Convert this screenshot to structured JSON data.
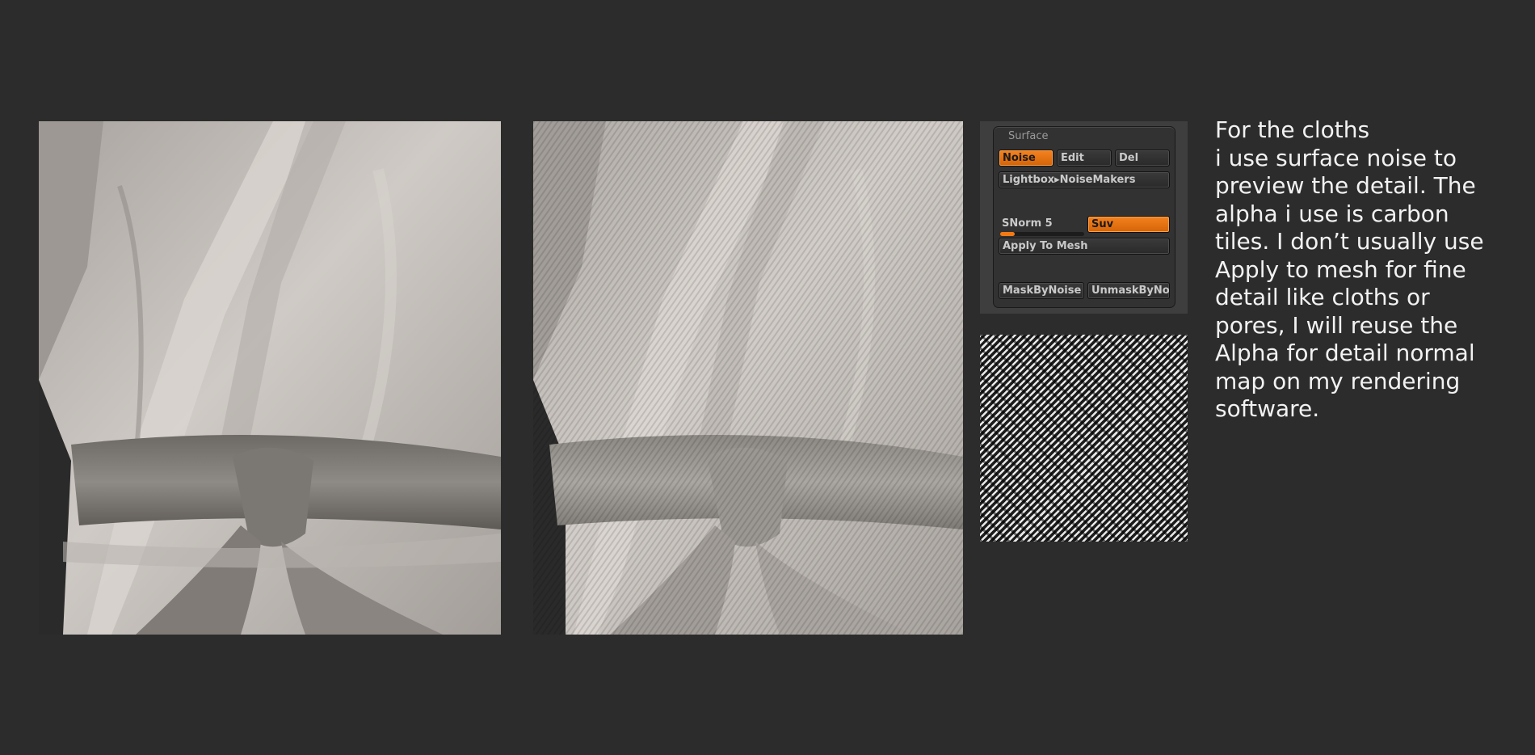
{
  "renders": {
    "before": {
      "description_name": "robe-render-without-noise",
      "cloth_color": "#bdb8b3",
      "belt_color": "#8a8580"
    },
    "after": {
      "description_name": "robe-render-with-surface-noise",
      "cloth_color": "#c2beb9",
      "belt_color": "#a8a39e"
    }
  },
  "surface_panel": {
    "title": "Surface",
    "noise_button": "Noise",
    "edit_button": "Edit",
    "del_button": "Del",
    "lightbox_button": "Lightbox▸NoiseMakers",
    "snorm_label": "SNorm 5",
    "snorm_value": 5,
    "suv_button": "Suv",
    "apply_button": "Apply To Mesh",
    "maskbynoise_button": "MaskByNoise",
    "unmaskbynoise_button": "UnmaskByNo",
    "accent_color": "#f27a14"
  },
  "alpha": {
    "icon": "carbon-tiles-alpha"
  },
  "note": {
    "lines": [
      "For the cloths",
      "i use surface noise to",
      "preview the detail. The",
      "alpha i use is carbon",
      "tiles. I don’t usually use",
      "Apply to mesh for fine",
      "detail like cloths or",
      "pores, I will reuse the",
      "Alpha for detail normal",
      "map on my rendering",
      "software."
    ]
  }
}
